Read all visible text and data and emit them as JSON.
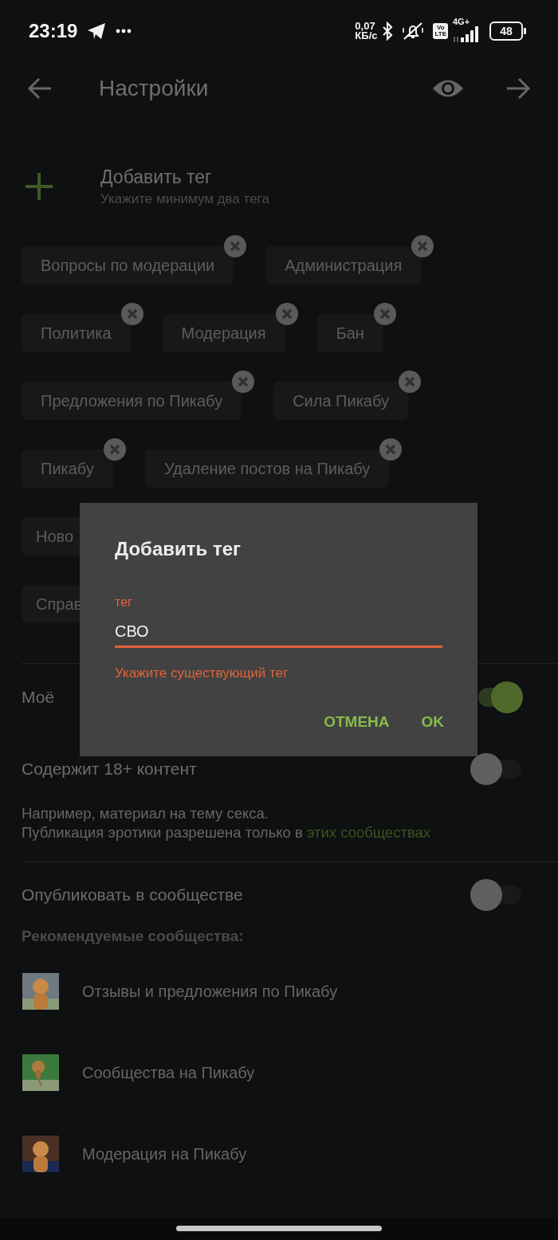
{
  "status_bar": {
    "time": "23:19",
    "net_speed": "0,07",
    "net_unit": "КБ/с",
    "volte": [
      "Vo",
      "LTE"
    ],
    "network": "4G+",
    "battery": "48"
  },
  "app_bar": {
    "title": "Настройки"
  },
  "add_tag": {
    "label": "Добавить тег",
    "hint": "Укажите минимум два тега"
  },
  "tag_rows": [
    [
      {
        "label": "Вопросы по модерации",
        "covered": false
      },
      {
        "label": "Администрация",
        "covered": false
      }
    ],
    [
      {
        "label": "Политика",
        "covered": false
      },
      {
        "label": "Модерация",
        "covered": false
      },
      {
        "label": "Бан",
        "covered": false
      }
    ],
    [
      {
        "label": "Предложения по Пикабу",
        "covered": false
      },
      {
        "label": "Сила Пикабу",
        "covered": false
      }
    ],
    [
      {
        "label": "Пикабу",
        "covered": false
      },
      {
        "label": "Удаление постов на Пикабу",
        "covered": false
      }
    ],
    [
      {
        "label": "Ново",
        "covered": true
      }
    ],
    [
      {
        "label": "Справ",
        "covered": true
      }
    ]
  ],
  "toggles": [
    {
      "label": "Моё",
      "on": true
    },
    {
      "label": "Содержит 18+ контент",
      "on": false
    }
  ],
  "note": {
    "text": "Например, материал на тему секса.\nПубликация эротики разрешена только в ",
    "link": "этих сообществах"
  },
  "publish_toggle": {
    "label": "Опубликовать в сообществе",
    "on": false
  },
  "recommended": {
    "heading": "Рекомендуемые сообщества:",
    "items": [
      {
        "name": "Отзывы и предложения по Пикабу",
        "kind": "picture"
      },
      {
        "name": "Сообщества на Пикабу",
        "kind": "picture"
      },
      {
        "name": "Модерация на Пикабу",
        "kind": "picture"
      }
    ]
  },
  "dialog": {
    "title": "Добавить тег",
    "field_label": "тег",
    "value": "СВО",
    "error": "Укажите существующий тег",
    "buttons": [
      "ОТМЕНА",
      "OK"
    ]
  }
}
